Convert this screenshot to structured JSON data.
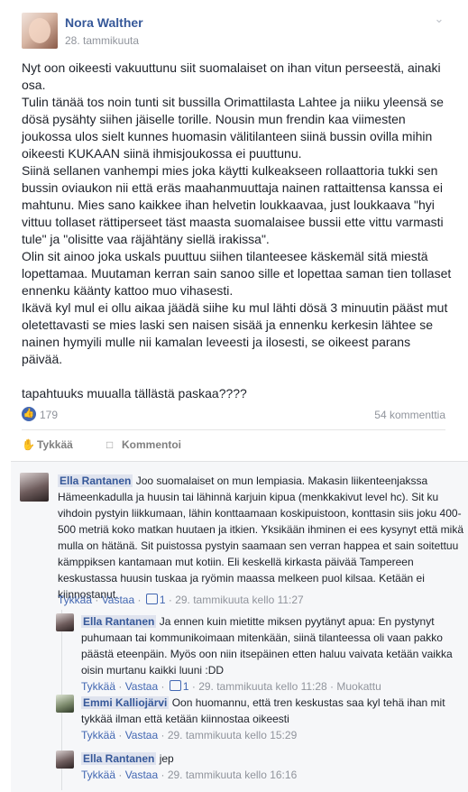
{
  "post": {
    "author": "Nora Walther",
    "timestamp": "28. tammikuuta",
    "paragraphs": [
      "Nyt oon oikeesti vakuuttunu siit suomalaiset on ihan vitun perseestä, ainaki osa.",
      "Tulin tänää tos noin tunti sit bussilla Orimattilasta Lahtee ja niiku yleensä se dösä pysähty siihen jäiselle torille. Nousin mun frendin kaa viimesten joukossa ulos sielt kunnes huomasin välitilanteen siinä bussin ovilla mihin oikeesti KUKAAN siinä ihmisjoukossa ei puuttunu.",
      "Siinä sellanen vanhempi mies joka käytti kulkeakseen rollaattoria tukki sen bussin oviaukon nii että eräs maahanmuuttaja nainen rattaittensa kanssa ei mahtunu. Mies sano kaikkee ihan helvetin loukkaavaa, just loukkaava \"hyi vittuu tollaset rättiperseet täst maasta suomalaisee bussii ette vittu varmasti tule\" ja \"olisitte vaa räjähtäny siellä irakissa\".",
      "Olin sit ainoo joka uskals puuttuu siihen tilanteesee käskemäl sitä miestä lopettamaa. Muutaman kerran sain sanoo sille et lopettaa saman tien tollaset ennenku käänty kattoo muo vihasesti.",
      "Ikävä kyl mul ei ollu aikaa jäädä siihe ku mul lähti dösä 3 minuutin pääst mut oletettavasti se mies laski sen naisen sisää ja ennenku kerkesin lähtee se nainen hymyili mulle nii kamalan leveesti ja ilosesti, se oikeest parans päivää."
    ],
    "closing": "tapahtuuks muualla tällästä paskaa????",
    "likes": "179",
    "comments_count": "54 kommenttia",
    "like_action": "Tykkää",
    "comment_action": "Kommentoi"
  },
  "comments": [
    {
      "name": "Ella Rantanen",
      "text": "Joo suomalaiset on mun lempiasia. Makasin liikenteenjakssa Hämeenkadulla ja huusin tai lähinnä karjuin kipua (menkkakivut level hc). Sit ku vihdoin pystyin liikkumaan, lähin konttaamaan koskipuistoon, konttasin siis joku 400-500 metriä koko matkan huutaen ja itkien. Yksikään ihminen ei ees kysynyt että mikä mulla on hätänä. Sit puistossa pystyin saamaan sen verran happea et sain soitettuu kämppiksen kantamaan mut kotiin. Eli keskellä kirkasta päivää Tampereen keskustassa huusin tuskaa ja ryömin maassa melkeen puol kilsaa. Ketään ei kiinnostanut.",
      "like": "Tykkää",
      "reply": "Vastaa",
      "reactions": "1",
      "time": "29. tammikuuta kello 11:27"
    },
    {
      "name": "Ella Rantanen",
      "text": "Ja ennen kuin mietitte miksen pyytänyt apua: En pystynyt puhumaan tai kommunikoimaan mitenkään, siinä tilanteessa oli vaan pakko päästä eteenpäin. Myös oon niin itsepäinen etten haluu vaivata ketään vaikka oisin murtanu kaikki luuni :DD",
      "like": "Tykkää",
      "reply": "Vastaa",
      "reactions": "1",
      "time": "29. tammikuuta kello 11:28",
      "edited": "Muokattu"
    },
    {
      "name": "Emmi Kalliojärvi",
      "text": "Oon huomannu, että tren keskustas saa kyl tehä ihan mit tykkää ilman että ketään kiinnostaa oikeesti",
      "like": "Tykkää",
      "reply": "Vastaa",
      "time": "29. tammikuuta kello 15:29"
    },
    {
      "name": "Ella Rantanen",
      "text": "jep",
      "like": "Tykkää",
      "reply": "Vastaa",
      "time": "29. tammikuuta kello 16:16"
    }
  ],
  "icons": {
    "menu": "chevron-down-icon",
    "like_badge": "thumbs-up-icon",
    "like_action": "thumbs-up-icon",
    "comment_action": "speech-bubble-icon"
  },
  "colors": {
    "link": "#365899",
    "accent": "#4267b2",
    "muted": "#90949c"
  }
}
